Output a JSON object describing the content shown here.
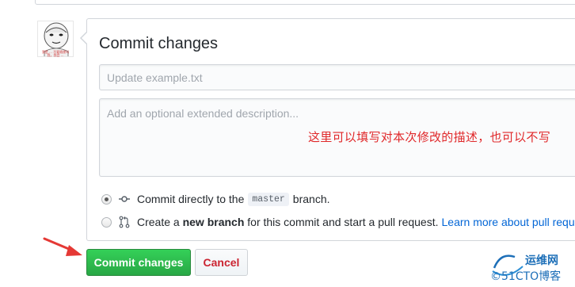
{
  "avatar": {
    "caption": "我是 ... 不要随便叫我，我会 ..."
  },
  "commit_form": {
    "title": "Commit changes",
    "summary_placeholder": "Update example.txt",
    "description_placeholder": "Add an optional extended description...",
    "annotation": "这里可以填写对本次修改的描述，也可以不写",
    "options": [
      {
        "selected": true,
        "icon": "git-commit-icon",
        "text_before": "Commit directly to the",
        "branch": "master",
        "text_after": "branch."
      },
      {
        "selected": false,
        "icon": "git-pull-request-icon",
        "text_before": "Create a",
        "bold": "new branch",
        "text_after": "for this commit and start a pull request.",
        "link": "Learn more about pull reque"
      }
    ],
    "commit_button": "Commit changes",
    "cancel_button": "Cancel"
  },
  "watermark": {
    "cn": "运维网",
    "en": "©51CTO博客"
  },
  "colors": {
    "commit_green": "#28a745",
    "cancel_red": "#cb2431",
    "link_blue": "#0366d6",
    "annotation_red": "#e0282a"
  }
}
